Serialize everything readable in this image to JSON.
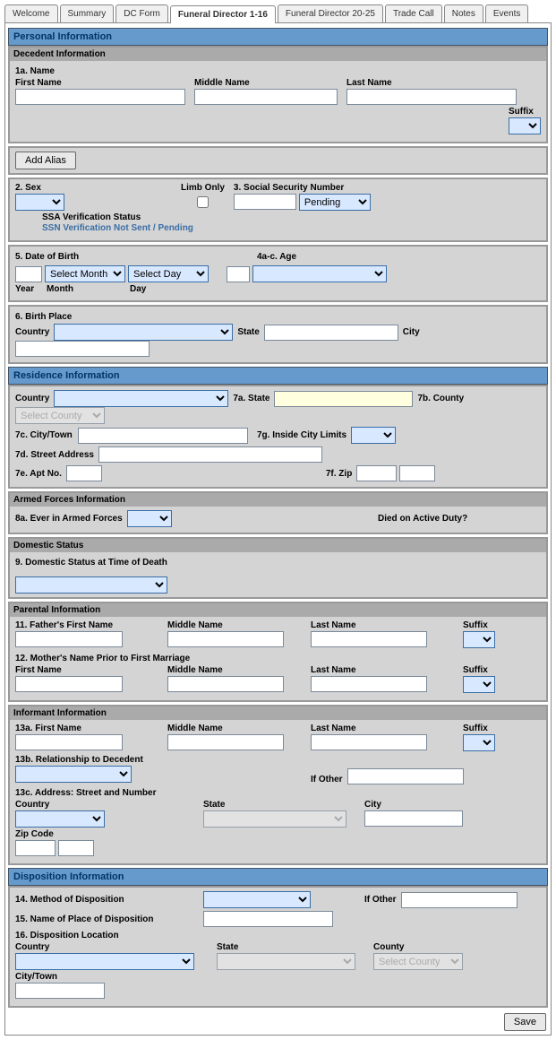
{
  "tabs": [
    "Welcome",
    "Summary",
    "DC Form",
    "Funeral Director 1-16",
    "Funeral Director 20-25",
    "Trade Call",
    "Notes",
    "Events"
  ],
  "active_tab": 3,
  "sections": {
    "personal": "Personal Information",
    "residence": "Residence Information",
    "disposition": "Disposition Information"
  },
  "decedent": {
    "header": "Decedent Information",
    "name_q": "1a. Name",
    "first": "First Name",
    "middle": "Middle Name",
    "last": "Last Name",
    "suffix": "Suffix",
    "add_alias": "Add Alias",
    "sex_q": "2. Sex",
    "limb_only": "Limb Only",
    "ssn_q": "3. Social Security Number",
    "ssn_status": "Pending",
    "ssa_lbl": "SSA Verification Status",
    "ssa_text": "SSN Verification Not Sent / Pending",
    "dob_q": "5. Date of Birth",
    "age_q": "4a-c. Age",
    "year": "Year",
    "month": "Month",
    "day": "Day",
    "sel_month": "Select Month",
    "sel_day": "Select Day",
    "birth_q": "6. Birth Place",
    "country": "Country",
    "state": "State",
    "city": "City"
  },
  "residence": {
    "country": "Country",
    "state_q": "7a. State",
    "county_q": "7b. County",
    "sel_county": "Select County",
    "city_q": "7c. City/Town",
    "limits_q": "7g. Inside City Limits",
    "street_q": "7d. Street Address",
    "apt_q": "7e. Apt No.",
    "zip_q": "7f. Zip"
  },
  "armed": {
    "header": "Armed Forces Information",
    "q": "8a. Ever in Armed Forces",
    "duty": "Died on Active Duty?"
  },
  "domestic": {
    "header": "Domestic Status",
    "q": "9. Domestic Status at Time of Death"
  },
  "parental": {
    "header": "Parental Information",
    "father_q": "11. Father's First Name",
    "mother_q": "12. Mother's Name Prior to First Marriage",
    "first": "First Name",
    "middle": "Middle Name",
    "last": "Last Name",
    "suffix": "Suffix"
  },
  "informant": {
    "header": "Informant Information",
    "first_q": "13a. First Name",
    "middle": "Middle Name",
    "last": "Last Name",
    "suffix": "Suffix",
    "rel_q": "13b. Relationship to Decedent",
    "other": "If Other",
    "addr_q": "13c. Address: Street and Number",
    "country": "Country",
    "state": "State",
    "city": "City",
    "zip": "Zip Code"
  },
  "dispo": {
    "method_q": "14. Method of Disposition",
    "other": "If Other",
    "place_q": "15. Name of Place of Disposition",
    "loc_q": "16. Disposition Location",
    "country": "Country",
    "state": "State",
    "county": "County",
    "city": "City/Town",
    "sel_county": "Select County"
  },
  "save": "Save"
}
